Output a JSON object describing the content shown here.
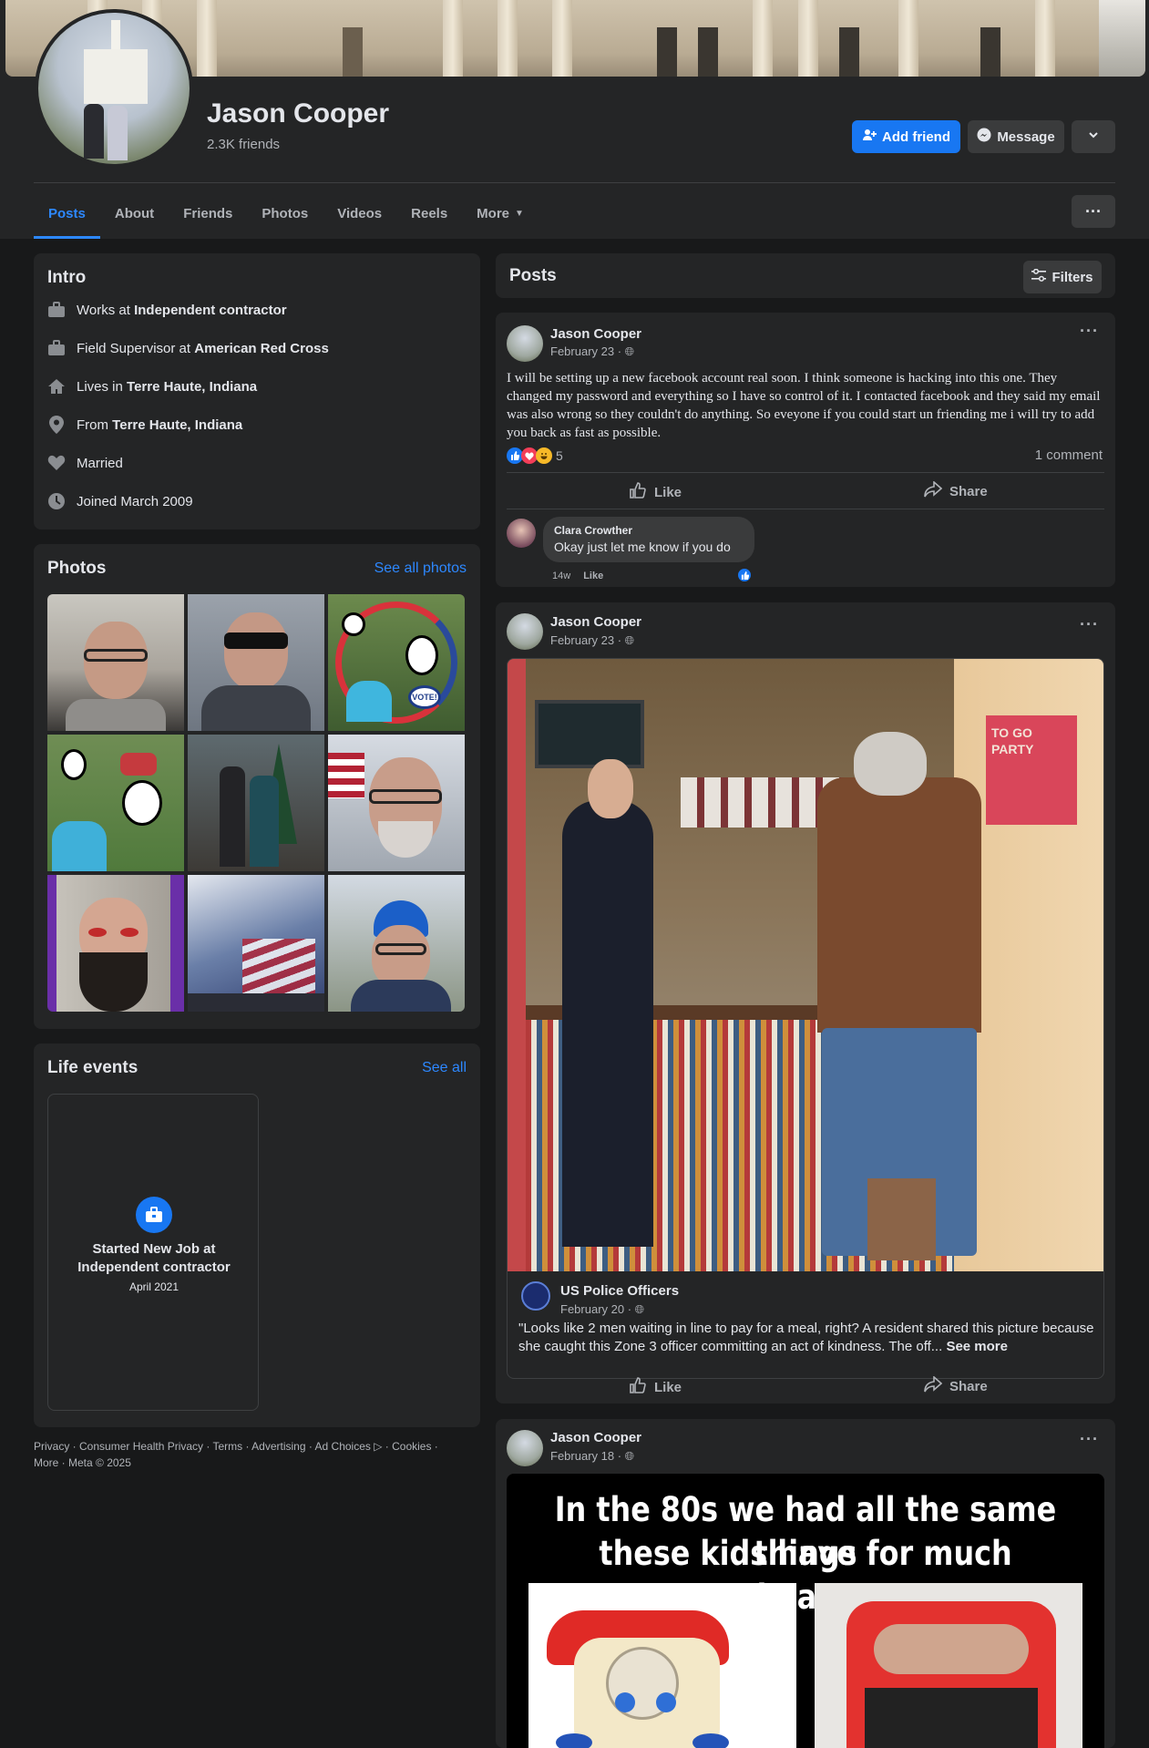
{
  "profile": {
    "name": "Jason Cooper",
    "friends": "2.3K friends",
    "add_friend": "Add friend",
    "message": "Message"
  },
  "tabs": [
    "Posts",
    "About",
    "Friends",
    "Photos",
    "Videos",
    "Reels",
    "More"
  ],
  "intro": {
    "title": "Intro",
    "items": [
      {
        "icon": "briefcase-icon",
        "prefix": "Works at ",
        "bold": "Independent contractor"
      },
      {
        "icon": "briefcase-icon",
        "prefix": "Field Supervisor at ",
        "bold": "American Red Cross"
      },
      {
        "icon": "home-icon",
        "prefix": "Lives in ",
        "bold": "Terre Haute, Indiana"
      },
      {
        "icon": "location-pin-icon",
        "prefix": "From ",
        "bold": "Terre Haute, Indiana"
      },
      {
        "icon": "heart-icon",
        "prefix": "Married",
        "bold": ""
      },
      {
        "icon": "clock-icon",
        "prefix": "Joined March 2009",
        "bold": ""
      }
    ]
  },
  "photos": {
    "title": "Photos",
    "see_all": "See all photos"
  },
  "life_events": {
    "title": "Life events",
    "see_all": "See all",
    "event_title": "Started New Job at Independent contractor",
    "event_date": "April 2021"
  },
  "footer": {
    "line1": "Privacy · Consumer Health Privacy · Terms · Advertising · Ad Choices ▷ · Cookies ·",
    "line2": "More · Meta © 2025"
  },
  "posts_header": {
    "title": "Posts",
    "filters": "Filters"
  },
  "post1": {
    "author": "Jason Cooper",
    "date": "February 23 ·",
    "text": "I will be setting up a new facebook account real soon. I think someone is hacking into this one. They changed my password and everything so I have so control of it. I contacted facebook and they said my email was also wrong so they couldn't do anything. So eveyone if you could start un friending me i will try to add you back as fast as possible.",
    "reactions": "5",
    "comments": "1 comment",
    "like": "Like",
    "share": "Share",
    "comment_author": "Clara Crowther",
    "comment_text": "Okay just let me know if you do",
    "comment_time": "14w",
    "comment_like": "Like"
  },
  "post2": {
    "author": "Jason Cooper",
    "date": "February 23 ·",
    "shared_page": "US Police Officers",
    "shared_date": "February 20 ·",
    "shared_text": "\"Looks like 2 men waiting in line to pay for a meal, right? A resident shared this picture because she caught this Zone 3 officer committing an act of kindness. The off...",
    "see_more": "See more",
    "like": "Like",
    "share": "Share",
    "image_sign": "TO GO PARTY"
  },
  "post3": {
    "author": "Jason Cooper",
    "date": "February 18 ·",
    "meme_line1": "In the 80s we had all the same things",
    "meme_line2": "these kids have for much cheaper"
  },
  "colors": {
    "background": "#18191a",
    "card": "#242526",
    "accent": "#1877f2",
    "link": "#2d88ff",
    "text": "#e4e6eb",
    "muted": "#b0b3b8"
  }
}
